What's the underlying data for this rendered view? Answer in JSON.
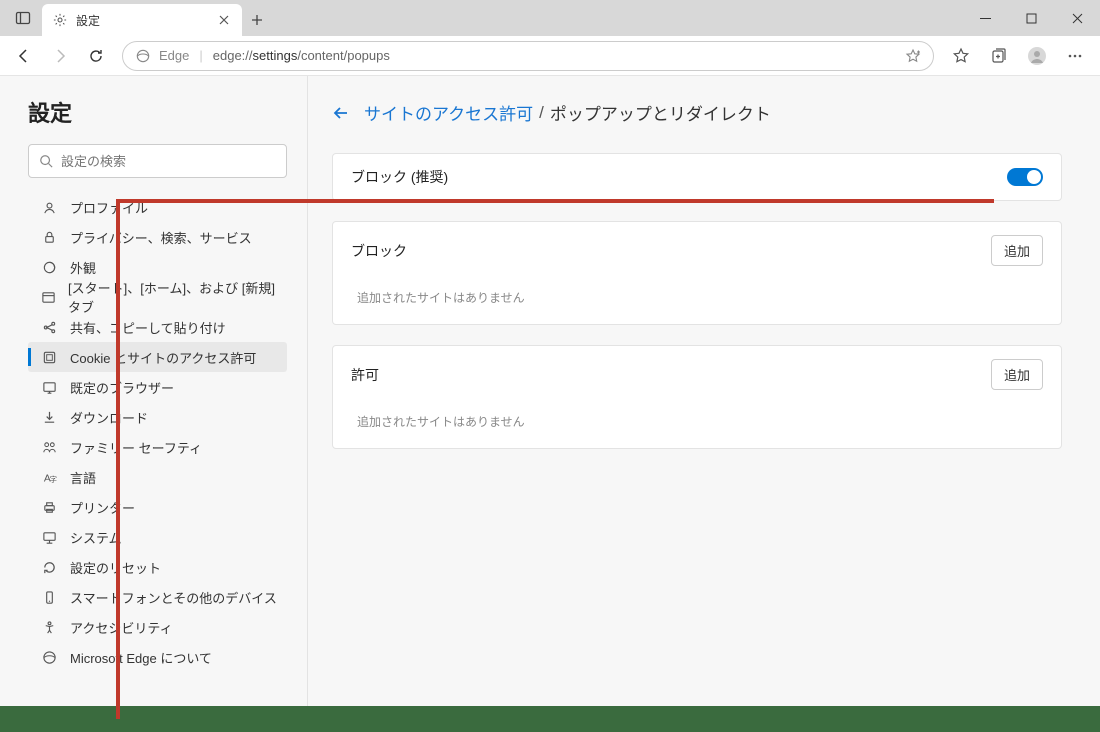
{
  "tab": {
    "title": "設定"
  },
  "toolbar": {
    "url_edge_label": "Edge",
    "url_prefix": "edge://",
    "url_bold": "settings",
    "url_rest": "/content/popups"
  },
  "sidebar": {
    "title": "設定",
    "search_placeholder": "設定の検索",
    "items": [
      {
        "label": "プロファイル"
      },
      {
        "label": "プライバシー、検索、サービス"
      },
      {
        "label": "外観"
      },
      {
        "label": "[スタート]、[ホーム]、および [新規] タブ"
      },
      {
        "label": "共有、コピーして貼り付け"
      },
      {
        "label": "Cookie とサイトのアクセス許可"
      },
      {
        "label": "既定のブラウザー"
      },
      {
        "label": "ダウンロード"
      },
      {
        "label": "ファミリー セーフティ"
      },
      {
        "label": "言語"
      },
      {
        "label": "プリンター"
      },
      {
        "label": "システム"
      },
      {
        "label": "設定のリセット"
      },
      {
        "label": "スマートフォンとその他のデバイス"
      },
      {
        "label": "アクセシビリティ"
      },
      {
        "label": "Microsoft Edge について"
      }
    ]
  },
  "main": {
    "breadcrumb_link": "サイトのアクセス許可",
    "breadcrumb_sep": "/",
    "breadcrumb_current": "ポップアップとリダイレクト",
    "block_recommended": "ブロック (推奨)",
    "block_section": "ブロック",
    "allow_section": "許可",
    "add_button": "追加",
    "empty_text": "追加されたサイトはありません"
  }
}
